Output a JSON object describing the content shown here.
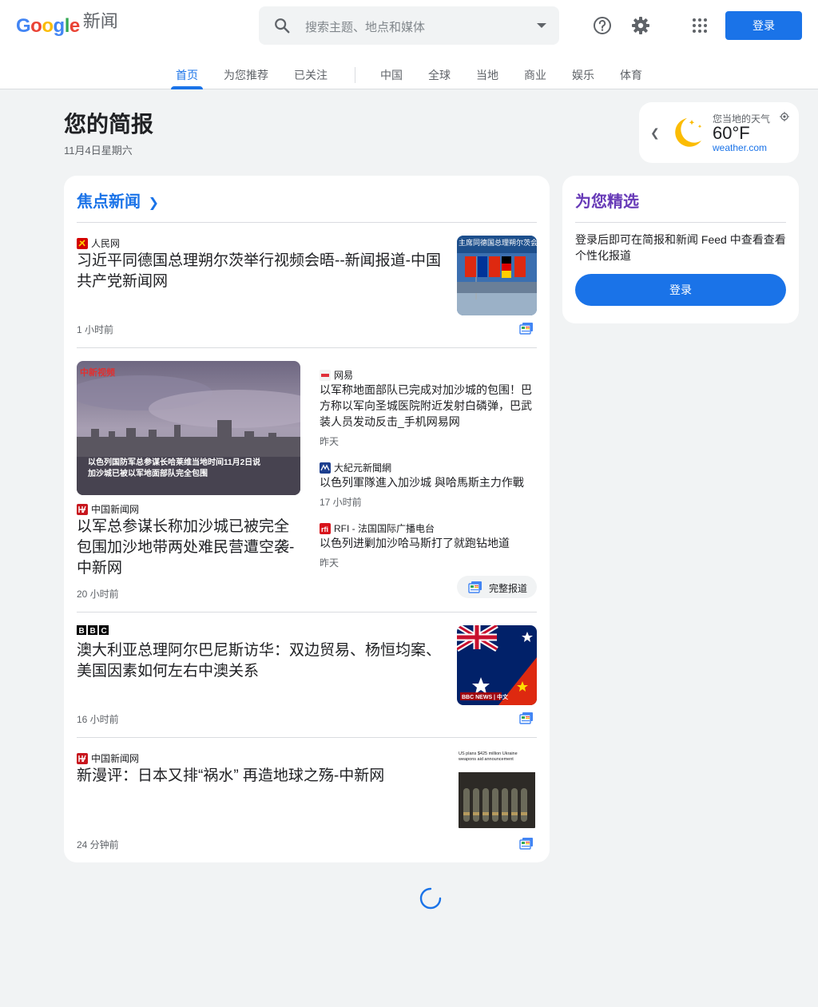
{
  "header": {
    "logo_google": "Google",
    "logo_news": "新闻",
    "search_placeholder": "搜索主题、地点和媒体",
    "signin": "登录"
  },
  "nav": {
    "tabs": [
      {
        "label": "首页",
        "active": true
      },
      {
        "label": "为您推荐"
      },
      {
        "label": "已关注"
      },
      {
        "label": "中国"
      },
      {
        "label": "全球"
      },
      {
        "label": "当地"
      },
      {
        "label": "商业"
      },
      {
        "label": "娱乐"
      },
      {
        "label": "体育"
      }
    ]
  },
  "briefing": {
    "title": "您的简报",
    "date": "11月4日星期六"
  },
  "weather": {
    "label": "您当地的天气",
    "temp": "60°F",
    "source": "weather.com"
  },
  "top_stories": {
    "title": "焦点新闻",
    "items": [
      {
        "source": "人民网",
        "headline": "习近平同德国总理朔尔茨举行视频会晤--新闻报道-中国共产党新闻网",
        "time": "1 小时前",
        "thumb_caption": "主席同德国总理朔尔茨会"
      },
      {
        "source": "中国新闻网",
        "headline": "以军总参谋长称加沙城已被完全包围加沙地带两处难民营遭空袭-中新网",
        "time": "20 小时前",
        "image_logo": "中新视频",
        "image_caption_1": "以色列国防军总参谋长哈莱维当地时间11月2日说",
        "image_caption_2": "加沙城已被以军地面部队完全包围",
        "related": [
          {
            "source": "网易",
            "headline": "以军称地面部队已完成对加沙城的包围！巴方称以军向圣城医院附近发射白磷弹，巴武装人员发动反击_手机网易网",
            "time": "昨天"
          },
          {
            "source": "大紀元新聞網",
            "headline": "以色列軍隊進入加沙城 與哈馬斯主力作戰",
            "time": "17 小时前"
          },
          {
            "source": "RFI - 法国国际广播电台",
            "headline": "以色列进剿加沙哈马斯打了就跑钻地道",
            "time": "昨天"
          }
        ],
        "full_coverage": "完整报道"
      },
      {
        "source": "BBC",
        "headline": "澳大利亚总理阿尔巴尼斯访华：双边贸易、杨恒均案、美国因素如何左右中澳关系",
        "time": "16 小时前",
        "thumb_caption": "BBC NEWS | 中文"
      },
      {
        "source": "中国新闻网",
        "headline": "新漫评：日本又排“祸水” 再造地球之殇-中新网",
        "time": "24 分钟前",
        "thumb_caption": "US plans $425 million Ukraine weapons aid announcement"
      }
    ]
  },
  "picks": {
    "title": "为您精选",
    "text": "登录后即可在简报和新闻 Feed 中查看查看个性化报道",
    "button": "登录"
  },
  "colors": {
    "accent": "#1a73e8",
    "picks_title": "#673ab7"
  }
}
